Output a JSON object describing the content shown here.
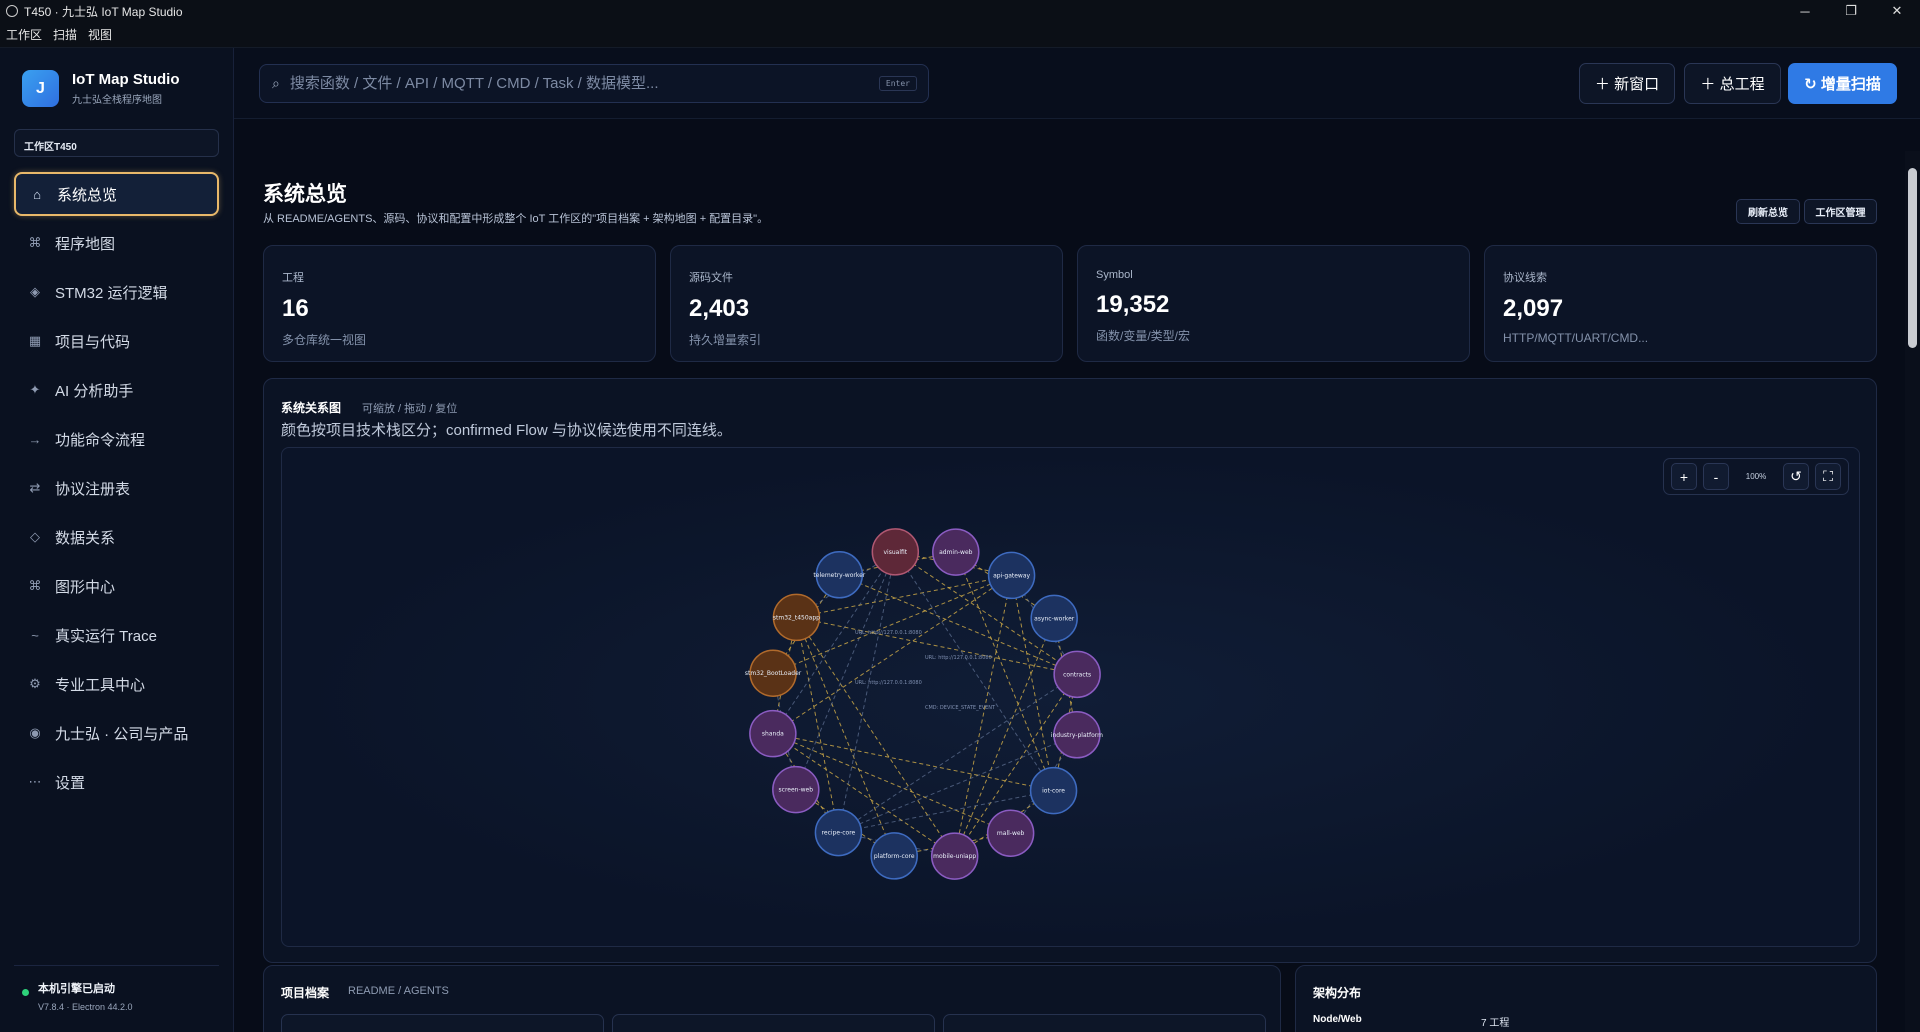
{
  "window": {
    "title": "T450 · 九士弘 IoT Map Studio",
    "controls": [
      "─",
      "❐",
      "✕"
    ]
  },
  "menubar": [
    "工作区",
    "扫描",
    "视图"
  ],
  "brand": {
    "logo_letter": "J",
    "title": "IoT Map Studio",
    "subtitle": "九士弘全栈程序地图"
  },
  "workspace": {
    "label": "工作区T450"
  },
  "nav": [
    {
      "icon": "home-icon",
      "glyph": "⌂",
      "label": "系统总览",
      "active": true
    },
    {
      "icon": "command-icon",
      "glyph": "⌘",
      "label": "程序地图"
    },
    {
      "icon": "diamond-icon",
      "glyph": "◈",
      "label": "STM32 运行逻辑"
    },
    {
      "icon": "grid-icon",
      "glyph": "▦",
      "label": "项目与代码"
    },
    {
      "icon": "sparkle-icon",
      "glyph": "✦",
      "label": "AI 分析助手"
    },
    {
      "icon": "arrow-right-icon",
      "glyph": "→",
      "label": "功能命令流程"
    },
    {
      "icon": "swap-icon",
      "glyph": "⇄",
      "label": "协议注册表"
    },
    {
      "icon": "diamond-outline-icon",
      "glyph": "◇",
      "label": "数据关系"
    },
    {
      "icon": "command-icon",
      "glyph": "⌘",
      "label": "图形中心"
    },
    {
      "icon": "wave-icon",
      "glyph": "~",
      "label": "真实运行 Trace"
    },
    {
      "icon": "gear-icon",
      "glyph": "⚙",
      "label": "专业工具中心"
    },
    {
      "icon": "target-icon",
      "glyph": "◉",
      "label": "九士弘 · 公司与产品"
    },
    {
      "icon": "dots-icon",
      "glyph": "⋯",
      "label": "设置"
    }
  ],
  "engine": {
    "status": "本机引擎已启动",
    "version": "V7.8.4 · Electron 44.2.0",
    "status_color": "#2ed27a"
  },
  "search": {
    "placeholder": "搜索函数 / 文件 / API / MQTT / CMD / Task / 数据模型...",
    "shortcut": "Enter"
  },
  "header_buttons": {
    "new_window": "＋ 新窗口",
    "master_project": "＋ 总工程",
    "incremental_scan": "↻ 增量扫描"
  },
  "page": {
    "title": "系统总览",
    "subtitle": "从 README/AGENTS、源码、协议和配置中形成整个 IoT 工作区的\"项目档案 + 架构地图 + 配置目录\"。",
    "refresh_button": "刷新总览",
    "workspace_button": "工作区管理"
  },
  "stats": [
    {
      "label": "工程",
      "value": "16",
      "desc": "多仓库统一视图"
    },
    {
      "label": "源码文件",
      "value": "2,403",
      "desc": "持久增量索引"
    },
    {
      "label": "Symbol",
      "value": "19,352",
      "desc": "函数/变量/类型/宏"
    },
    {
      "label": "协议线索",
      "value": "2,097",
      "desc": "HTTP/MQTT/UART/CMD..."
    }
  ],
  "graph": {
    "title": "系统关系图",
    "hint": "可缩放 / 拖动 / 复位",
    "subtitle": "颜色按项目技术栈区分；confirmed Flow 与协议候选使用不同连线。",
    "zoom_in": "+",
    "zoom_out": "-",
    "zoom_level": "100%",
    "reset": "↺",
    "fullscreen": "⛶",
    "colors": {
      "node_web": "#4a2a5e",
      "node_web_stroke": "#8b5cc2",
      "node_service": "#1c3260",
      "node_service_stroke": "#3e6bc0",
      "node_firmware": "#5a3216",
      "node_firmware_stroke": "#b06a2c",
      "node_visual": "#5e2838",
      "node_visual_stroke": "#b05872",
      "edge_flow": "#e0b84a",
      "edge_candidate": "#6f82a6"
    },
    "nodes": [
      {
        "name": "admin-web",
        "kind": "web"
      },
      {
        "name": "api-gateway",
        "kind": "service"
      },
      {
        "name": "async-worker",
        "kind": "service"
      },
      {
        "name": "contracts",
        "kind": "web"
      },
      {
        "name": "industry-platform",
        "kind": "web"
      },
      {
        "name": "iot-core",
        "kind": "service"
      },
      {
        "name": "mall-web",
        "kind": "web"
      },
      {
        "name": "mobile-uniapp",
        "kind": "web"
      },
      {
        "name": "platform-core",
        "kind": "service"
      },
      {
        "name": "recipe-core",
        "kind": "service"
      },
      {
        "name": "screen-web",
        "kind": "web"
      },
      {
        "name": "shanda",
        "kind": "web"
      },
      {
        "name": "stm32_BootLoader",
        "kind": "firmware"
      },
      {
        "name": "stm32_t450app",
        "kind": "firmware"
      },
      {
        "name": "telemetry-worker",
        "kind": "service"
      },
      {
        "name": "visualfit",
        "kind": "visual"
      }
    ],
    "edge_labels": [
      "URL: http://127.0.0.1:8080",
      "URL: http://127.0.0.1:8080",
      "URL: http://127.0.0.1:8080",
      "CMD: DEVICE_STATE_EVENT"
    ]
  },
  "bottom": {
    "archive_title": "项目档案",
    "archive_hint": "README / AGENTS",
    "arch_title": "架构分布",
    "arch_row_label": "Node/Web",
    "arch_row_value": "7 工程"
  }
}
